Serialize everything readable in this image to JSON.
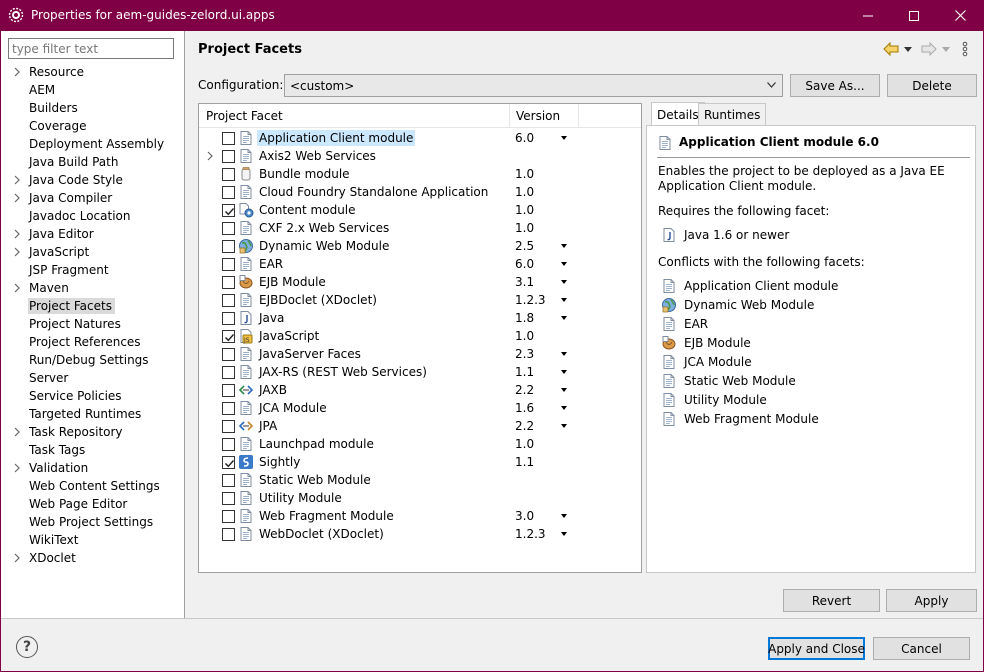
{
  "window": {
    "title": "Properties for aem-guides-zelord.ui.apps"
  },
  "filter": {
    "placeholder": "type filter text"
  },
  "nav": {
    "items": [
      {
        "label": "Resource",
        "expandable": true
      },
      {
        "label": "AEM",
        "expandable": false
      },
      {
        "label": "Builders",
        "expandable": false
      },
      {
        "label": "Coverage",
        "expandable": false
      },
      {
        "label": "Deployment Assembly",
        "expandable": false
      },
      {
        "label": "Java Build Path",
        "expandable": false
      },
      {
        "label": "Java Code Style",
        "expandable": true
      },
      {
        "label": "Java Compiler",
        "expandable": true
      },
      {
        "label": "Javadoc Location",
        "expandable": false
      },
      {
        "label": "Java Editor",
        "expandable": true
      },
      {
        "label": "JavaScript",
        "expandable": true
      },
      {
        "label": "JSP Fragment",
        "expandable": false
      },
      {
        "label": "Maven",
        "expandable": true
      },
      {
        "label": "Project Facets",
        "expandable": false,
        "selected": true
      },
      {
        "label": "Project Natures",
        "expandable": false
      },
      {
        "label": "Project References",
        "expandable": false
      },
      {
        "label": "Run/Debug Settings",
        "expandable": false
      },
      {
        "label": "Server",
        "expandable": false
      },
      {
        "label": "Service Policies",
        "expandable": false
      },
      {
        "label": "Targeted Runtimes",
        "expandable": false
      },
      {
        "label": "Task Repository",
        "expandable": true
      },
      {
        "label": "Task Tags",
        "expandable": false
      },
      {
        "label": "Validation",
        "expandable": true
      },
      {
        "label": "Web Content Settings",
        "expandable": false
      },
      {
        "label": "Web Page Editor",
        "expandable": false
      },
      {
        "label": "Web Project Settings",
        "expandable": false
      },
      {
        "label": "WikiText",
        "expandable": false
      },
      {
        "label": "XDoclet",
        "expandable": true
      }
    ]
  },
  "page": {
    "title": "Project Facets",
    "configuration_label": "Configuration:",
    "configuration_value": "<custom>",
    "save_as": "Save As...",
    "delete": "Delete"
  },
  "facets": {
    "col_facet": "Project Facet",
    "col_version": "Version",
    "rows": [
      {
        "name": "Application Client module",
        "version": "6.0",
        "checked": false,
        "dropdown": true,
        "icon": "page-icon",
        "selected": true
      },
      {
        "name": "Axis2 Web Services",
        "version": "",
        "checked": false,
        "dropdown": false,
        "icon": "page-icon",
        "expandable": true
      },
      {
        "name": "Bundle module",
        "version": "1.0",
        "checked": false,
        "dropdown": false,
        "icon": "jar-icon"
      },
      {
        "name": "Cloud Foundry Standalone Application",
        "version": "1.0",
        "checked": false,
        "dropdown": false,
        "icon": "page-icon"
      },
      {
        "name": "Content module",
        "version": "1.0",
        "checked": true,
        "dropdown": false,
        "icon": "content-icon"
      },
      {
        "name": "CXF 2.x Web Services",
        "version": "1.0",
        "checked": false,
        "dropdown": false,
        "icon": "page-icon"
      },
      {
        "name": "Dynamic Web Module",
        "version": "2.5",
        "checked": false,
        "dropdown": true,
        "icon": "globe-icon"
      },
      {
        "name": "EAR",
        "version": "6.0",
        "checked": false,
        "dropdown": true,
        "icon": "page-icon"
      },
      {
        "name": "EJB Module",
        "version": "3.1",
        "checked": false,
        "dropdown": true,
        "icon": "bean-icon"
      },
      {
        "name": "EJBDoclet (XDoclet)",
        "version": "1.2.3",
        "checked": false,
        "dropdown": true,
        "icon": "page-icon"
      },
      {
        "name": "Java",
        "version": "1.8",
        "checked": false,
        "dropdown": true,
        "icon": "java-icon"
      },
      {
        "name": "JavaScript",
        "version": "1.0",
        "checked": true,
        "dropdown": false,
        "icon": "javascript-icon"
      },
      {
        "name": "JavaServer Faces",
        "version": "2.3",
        "checked": false,
        "dropdown": true,
        "icon": "page-icon"
      },
      {
        "name": "JAX-RS (REST Web Services)",
        "version": "1.1",
        "checked": false,
        "dropdown": true,
        "icon": "page-icon"
      },
      {
        "name": "JAXB",
        "version": "2.2",
        "checked": false,
        "dropdown": true,
        "icon": "jaxb-icon"
      },
      {
        "name": "JCA Module",
        "version": "1.6",
        "checked": false,
        "dropdown": true,
        "icon": "page-icon"
      },
      {
        "name": "JPA",
        "version": "2.2",
        "checked": false,
        "dropdown": true,
        "icon": "jpa-icon"
      },
      {
        "name": "Launchpad module",
        "version": "1.0",
        "checked": false,
        "dropdown": false,
        "icon": "page-icon"
      },
      {
        "name": "Sightly",
        "version": "1.1",
        "checked": true,
        "dropdown": false,
        "icon": "sightly-icon"
      },
      {
        "name": "Static Web Module",
        "version": "",
        "checked": false,
        "dropdown": false,
        "icon": "page-icon"
      },
      {
        "name": "Utility Module",
        "version": "",
        "checked": false,
        "dropdown": false,
        "icon": "page-icon"
      },
      {
        "name": "Web Fragment Module",
        "version": "3.0",
        "checked": false,
        "dropdown": true,
        "icon": "page-icon"
      },
      {
        "name": "WebDoclet (XDoclet)",
        "version": "1.2.3",
        "checked": false,
        "dropdown": true,
        "icon": "page-icon"
      }
    ]
  },
  "details": {
    "tab_details": "Details",
    "tab_runtimes": "Runtimes",
    "title": "Application Client module 6.0",
    "description": "Enables the project to be deployed as a Java EE Application Client module.",
    "requires_label": "Requires the following facet:",
    "requires": [
      {
        "label": "Java 1.6 or newer",
        "icon": "java-icon"
      }
    ],
    "conflicts_label": "Conflicts with the following facets:",
    "conflicts": [
      {
        "label": "Application Client module",
        "icon": "page-icon"
      },
      {
        "label": "Dynamic Web Module",
        "icon": "globe-icon"
      },
      {
        "label": "EAR",
        "icon": "page-icon"
      },
      {
        "label": "EJB Module",
        "icon": "bean-icon"
      },
      {
        "label": "JCA Module",
        "icon": "page-icon"
      },
      {
        "label": "Static Web Module",
        "icon": "page-icon"
      },
      {
        "label": "Utility Module",
        "icon": "page-icon"
      },
      {
        "label": "Web Fragment Module",
        "icon": "page-icon"
      }
    ]
  },
  "buttons": {
    "revert": "Revert",
    "apply": "Apply",
    "apply_and_close": "Apply and Close",
    "cancel": "Cancel"
  },
  "colors": {
    "titlebar": "#800046",
    "selection": "#cce8ff",
    "primary_border": "#0078d7"
  }
}
